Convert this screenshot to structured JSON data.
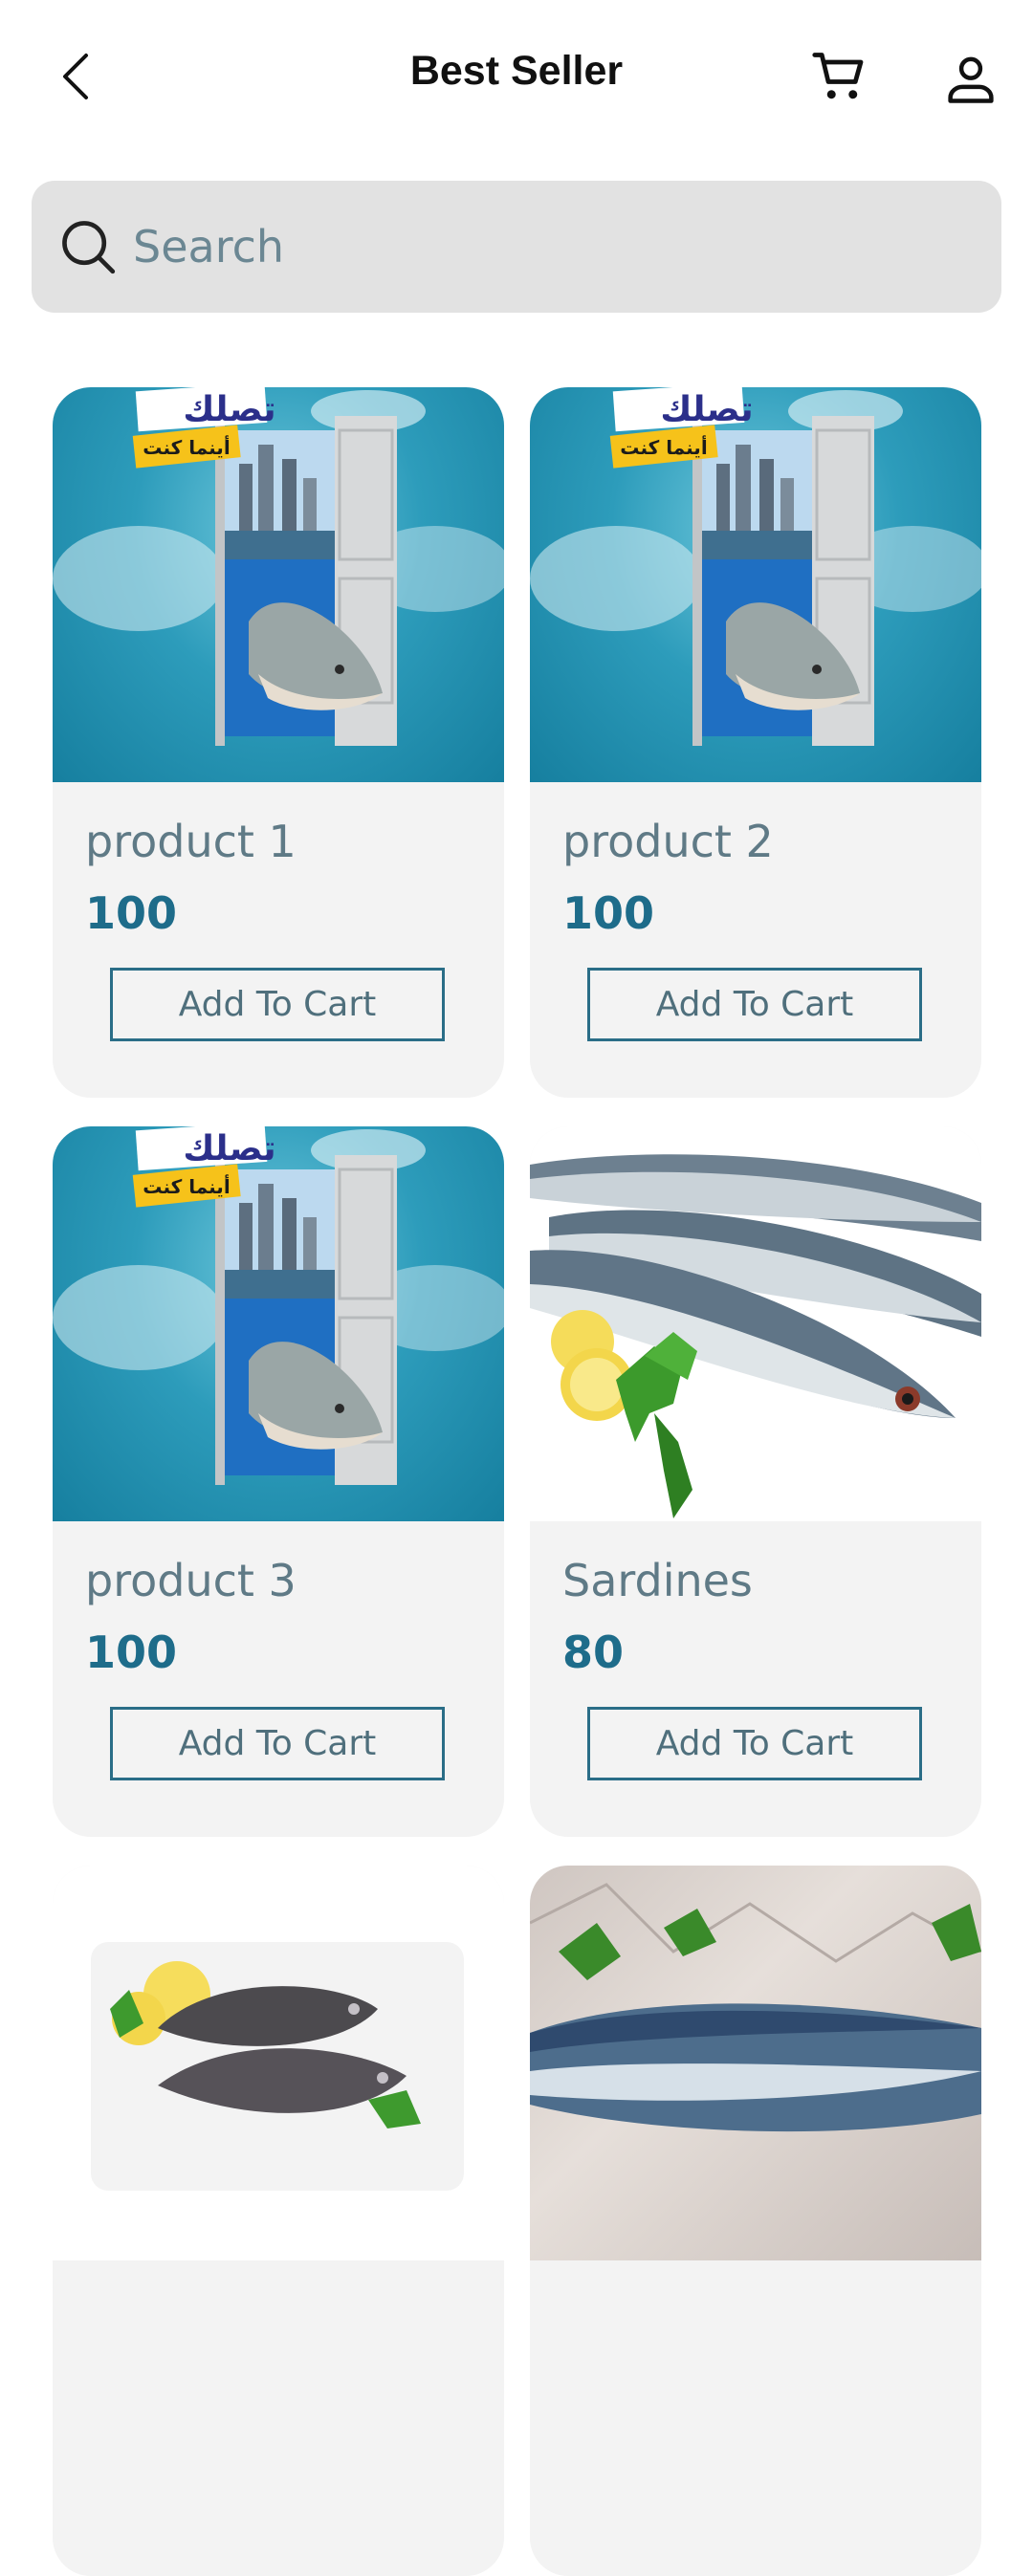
{
  "header": {
    "title": "Best Seller",
    "back_icon": "chevron-left-icon",
    "cart_icon": "cart-icon",
    "profile_icon": "user-icon"
  },
  "search": {
    "placeholder": "Search",
    "icon": "search-icon"
  },
  "products": [
    {
      "name": "product 1",
      "price": "100",
      "button": "Add To Cart",
      "image": "promo-door-fish",
      "promo_text_1": "تصلك",
      "promo_text_2": "أينما كنت"
    },
    {
      "name": "product 2",
      "price": "100",
      "button": "Add To Cart",
      "image": "promo-door-fish",
      "promo_text_1": "تصلك",
      "promo_text_2": "أينما كنت"
    },
    {
      "name": "product 3",
      "price": "100",
      "button": "Add To Cart",
      "image": "promo-door-fish",
      "promo_text_1": "تصلك",
      "promo_text_2": "أينما كنت"
    },
    {
      "name": "Sardines",
      "price": "80",
      "button": "Add To Cart",
      "image": "mackerel-with-lemon"
    },
    {
      "image": "tilapia-with-lemon"
    },
    {
      "image": "fish-on-paper"
    }
  ],
  "colors": {
    "accent": "#1e6c8a",
    "name_text": "#5f7a86",
    "card_bg": "#f3f3f3",
    "search_bg": "#e2e2e2"
  }
}
